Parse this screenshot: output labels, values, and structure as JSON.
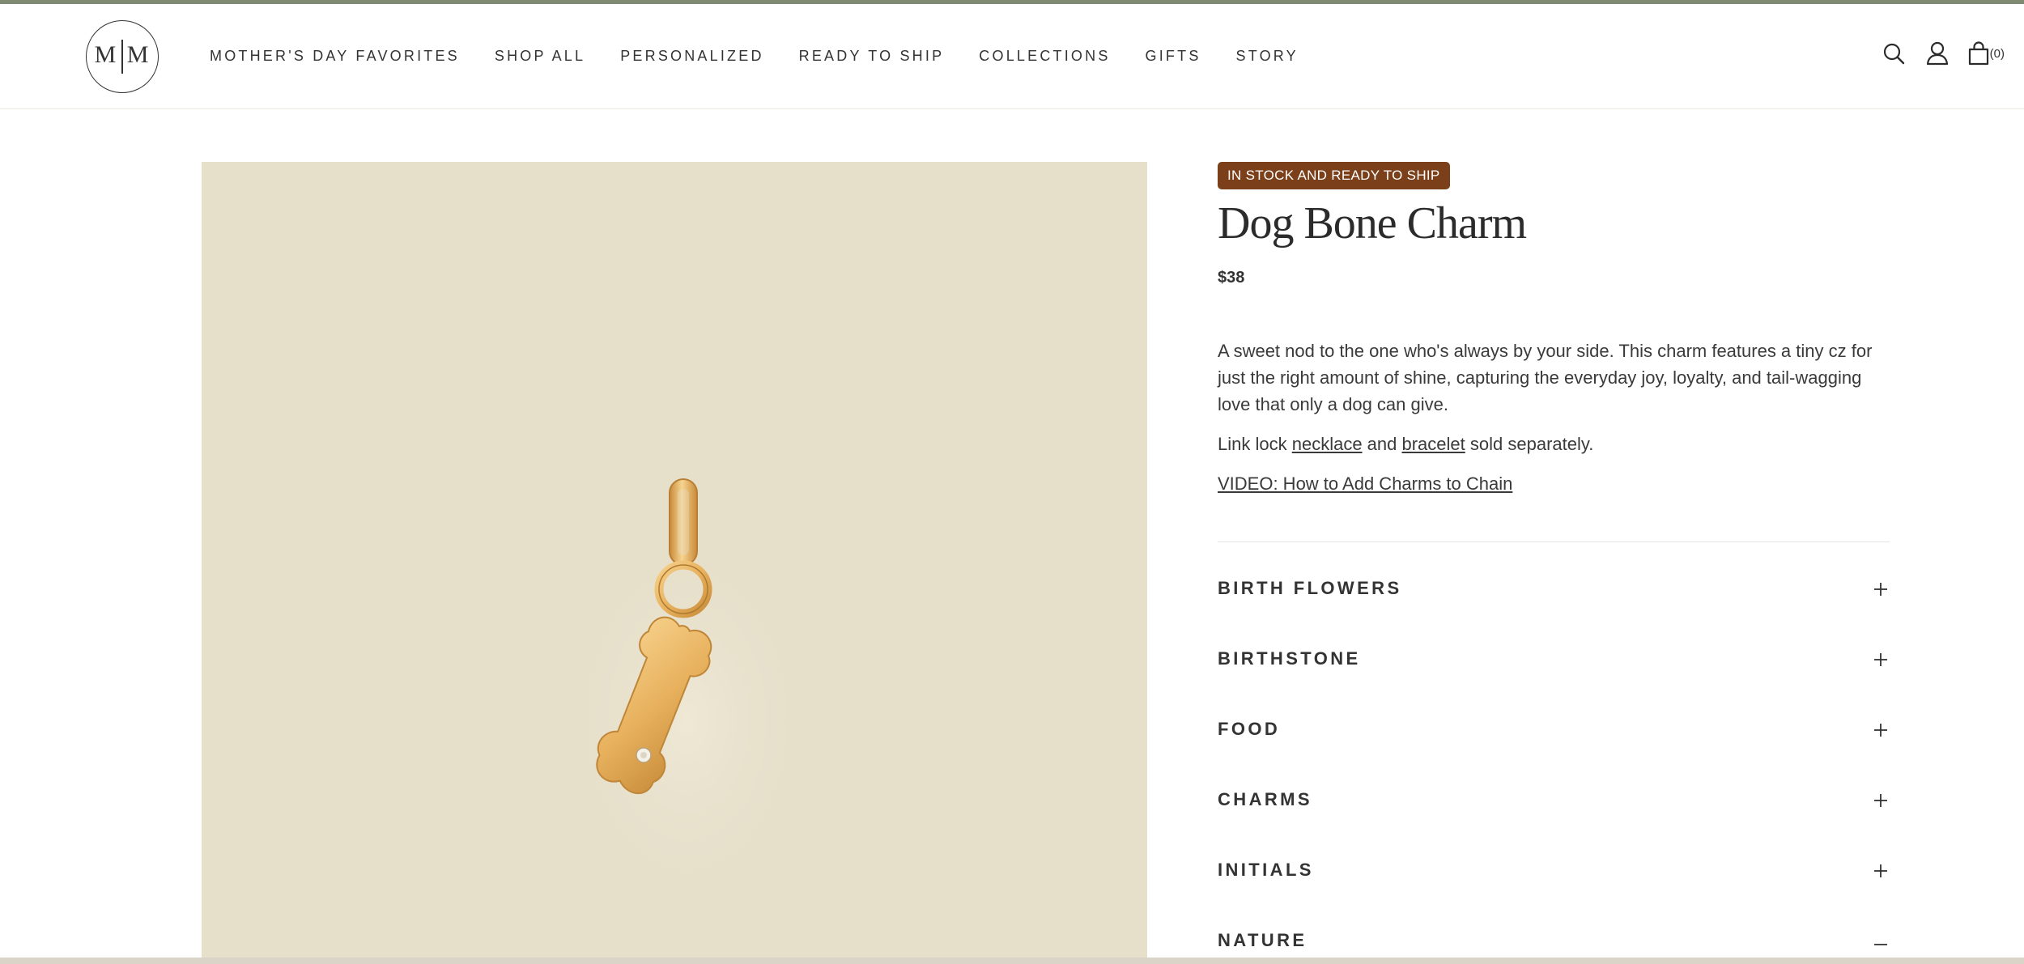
{
  "header": {
    "logo_text": "M|M",
    "nav": [
      {
        "label": "MOTHER'S DAY FAVORITES"
      },
      {
        "label": "SHOP ALL"
      },
      {
        "label": "PERSONALIZED"
      },
      {
        "label": "READY TO SHIP"
      },
      {
        "label": "COLLECTIONS"
      },
      {
        "label": "GIFTS"
      },
      {
        "label": "STORY"
      }
    ],
    "icons": [
      "search-icon",
      "account-icon",
      "bag-icon"
    ],
    "cart_count": "(0)"
  },
  "product": {
    "badge": "IN STOCK AND READY TO SHIP",
    "title": "Dog Bone Charm",
    "price": "$38",
    "description": "A sweet nod to the one who's always by your side. This charm features a tiny cz for just the right amount of shine, capturing the everyday joy, loyalty, and tail-wagging love that only a dog can give.",
    "sold_separately": {
      "prefix": "Link lock ",
      "link1": "necklace",
      "middle": " and ",
      "link2": "bracelet",
      "suffix": " sold separately."
    },
    "video_link": "VIDEO: How to Add Charms to Chain"
  },
  "accordions": [
    {
      "label": "BIRTH FLOWERS",
      "state": "+"
    },
    {
      "label": "BIRTHSTONE",
      "state": "+"
    },
    {
      "label": "FOOD",
      "state": "+"
    },
    {
      "label": "CHARMS",
      "state": "+"
    },
    {
      "label": "INITIALS",
      "state": "+"
    },
    {
      "label": "NATURE",
      "state": "–"
    }
  ],
  "colors": {
    "badge_bg": "#7b3f1a",
    "gallery_bg": "#e6dfca",
    "charm_gold": "#e8b25f"
  }
}
